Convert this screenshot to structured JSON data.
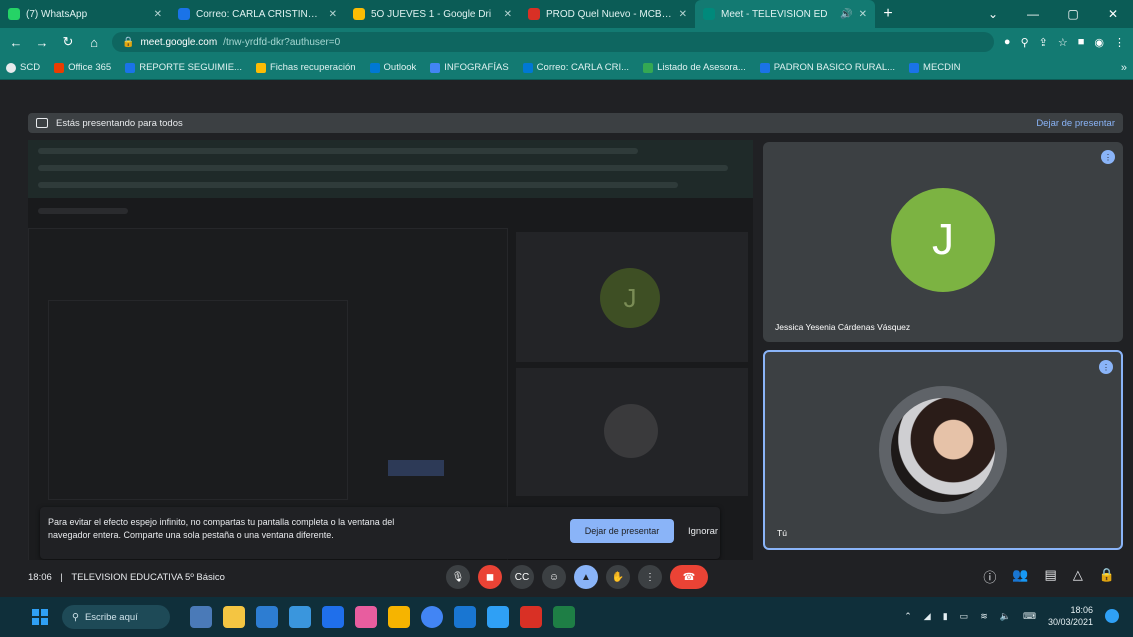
{
  "browser": {
    "tabs": [
      {
        "title": "(7) WhatsApp",
        "color": "#25d366"
      },
      {
        "title": "Correo: CARLA CRISTINA C/",
        "color": "#1a73e8"
      },
      {
        "title": "5O JUEVES 1 - Google Dri",
        "color": "#fbbc04"
      },
      {
        "title": "PROD Quel Nuevo - MCBTC",
        "color": "#d93025"
      },
      {
        "title": "Meet - TELEVISION ED",
        "color": "#00897b",
        "active": true
      }
    ],
    "new_tab": "+",
    "url_host": "meet.google.com",
    "url_path": "/tnw-yrdfd-dkr?authuser=0",
    "bookmarks": [
      {
        "label": "SCD",
        "color": "#e8eaed"
      },
      {
        "label": "Office 365",
        "color": "#eb3c00"
      },
      {
        "label": "REPORTE SEGUIMIE...",
        "color": "#1a73e8"
      },
      {
        "label": "Fichas recuperación",
        "color": "#fbbc04"
      },
      {
        "label": "Outlook",
        "color": "#0078d4"
      },
      {
        "label": "INFOGRAFÍAS",
        "color": "#4285f4"
      },
      {
        "label": "Correo: CARLA CRI...",
        "color": "#0078d4"
      },
      {
        "label": "Listado de Asesora...",
        "color": "#34a853"
      },
      {
        "label": "PADRON BASICO RURAL...",
        "color": "#1a73e8"
      },
      {
        "label": "MECDIN",
        "color": "#1a73e8"
      }
    ]
  },
  "meet": {
    "presenting_label": "Estás presentando para todos",
    "stop_presenting": "Dejar de presentar",
    "participants": [
      {
        "initial": "J",
        "name": "Jessica Yesenia Cárdenas Vásquez",
        "avatar_color": "#7cb342"
      },
      {
        "name": "Tú"
      }
    ],
    "notice": {
      "text": "Para evitar el efecto espejo infinito, no compartas tu pantalla completa o la ventana del navegador entera. Comparte una sola pestaña o una ventana diferente.",
      "primary": "Dejar de presentar",
      "secondary": "Ignorar"
    },
    "meeting_info": {
      "time": "18:06",
      "separator": "|",
      "title": "TELEVISION EDUCATIVA 5º Básico"
    }
  },
  "taskbar": {
    "search_label": "Escribe aquí",
    "time": "18:06",
    "date": "30/03/2021"
  }
}
